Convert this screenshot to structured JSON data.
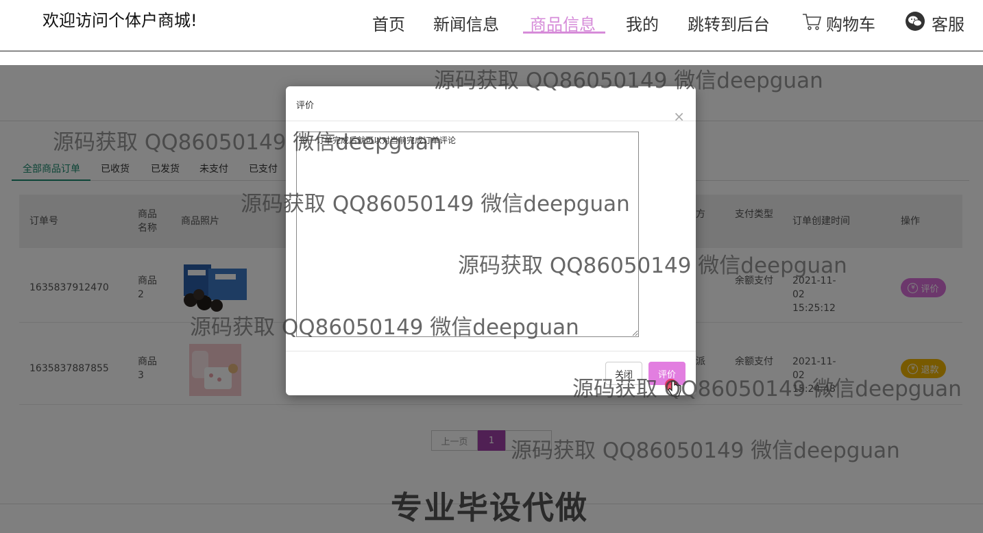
{
  "header": {
    "welcome": "欢迎访问个体户商城!",
    "nav": [
      "首页",
      "新闻信息",
      "商品信息",
      "我的",
      "跳转到后台",
      "购物车",
      "客服"
    ],
    "active_nav": "商品信息",
    "accent_color": "#d68bd9"
  },
  "tabs": [
    "全部商品订单",
    "已收货",
    "已发货",
    "未支付",
    "已支付"
  ],
  "table": {
    "headers": {
      "order_no": "订单号",
      "product_name": "商品名称",
      "product_photo": "商品照片",
      "pay_method_partial": "方",
      "pay_type": "支付类型",
      "created_time": "订单创建时间",
      "action": "操作"
    },
    "rows": [
      {
        "order_no": "1635837912470",
        "product_name": "商品2",
        "pay_type": "余额支付",
        "created_time": "2021-11-02 15:25:12",
        "action": "评价",
        "action_icon": "yen-coin-icon"
      },
      {
        "order_no": "1635837887855",
        "product_name": "商品3",
        "pay_method_partial": "派",
        "pay_type": "余额支付",
        "created_time": "2021-11-02 15:24:48",
        "action": "退款",
        "action_icon": "yen-coin-icon"
      }
    ]
  },
  "pagination": {
    "prev": "上一页",
    "current": "1"
  },
  "banner": "专业毕设代做",
  "modal": {
    "title": "评价",
    "close_glyph": "×",
    "textarea_value": "每一订单完成后就可以对当前完成订单评论",
    "btn_close": "关闭",
    "btn_confirm": "评价"
  },
  "watermark": "源码获取 QQ86050149 微信deepguan"
}
